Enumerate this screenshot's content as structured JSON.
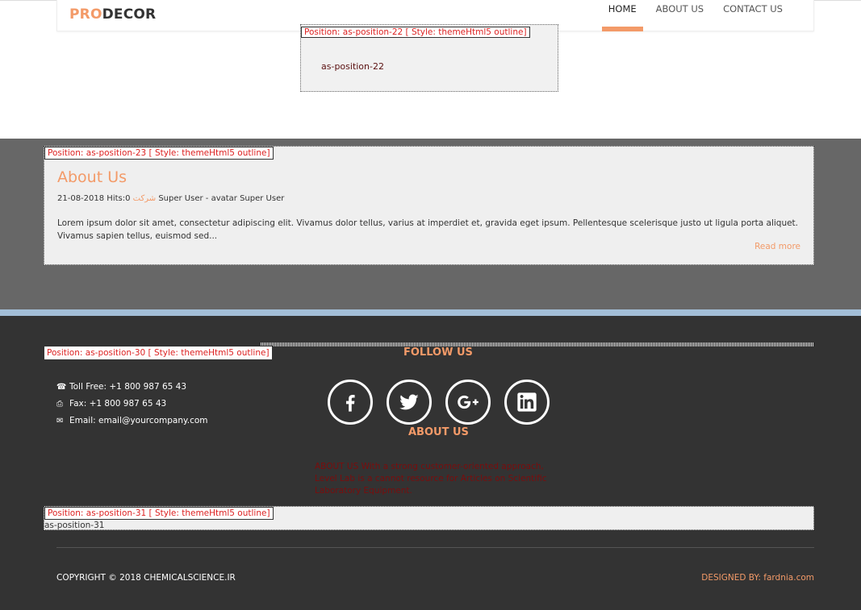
{
  "header": {
    "logo_pro": "PRO",
    "logo_decor": "DECOR",
    "nav": [
      {
        "label": "HOME"
      },
      {
        "label": "ABOUT US"
      },
      {
        "label": "CONTACT US"
      }
    ]
  },
  "pos22": {
    "tag": "Position: as-position-22 [ Style: themeHtml5 outline]",
    "body": "as-position-22"
  },
  "pos23": {
    "tag": "Position: as-position-23 [ Style: themeHtml5 outline]",
    "title": "About Us",
    "meta_date_hits": "21-08-2018 Hits:0",
    "meta_category": "شرکت",
    "meta_author": "Super User - avatar Super User",
    "excerpt": "Lorem ipsum dolor sit amet, consectetur adipiscing elit. Vivamus dolor tellus, varius at imperdiet et, gravida eget ipsum. Pellentesque scelerisque justo ut ligula porta aliquet. Vivamus sapien tellus, euismod sed...",
    "read_more": "Read more"
  },
  "pos30": {
    "tag": "Position: as-position-30 [ Style: themeHtml5 outline]",
    "follow_title": "FOLLOW US",
    "contact": {
      "toll_free": "Toll Free: +1 800 987 65 43",
      "fax": "Fax: +1 800 987 65 43",
      "email": "Email: email@yourcompany.com"
    },
    "socials": [
      "facebook-icon",
      "twitter-icon",
      "google-plus-icon",
      "linkedin-icon"
    ],
    "about_title": "ABOUT US",
    "about_text": "ABOUT US With a strong customer-oriented approach, Level Lab is a cannot resource for Articles on Scientific Laboratory Equipment."
  },
  "pos31": {
    "tag": "Position: as-position-31 [ Style: themeHtml5 outline]",
    "body": "as-position-31"
  },
  "footer": {
    "copyright": "COPYRIGHT © 2018 CHEMICALSCIENCE.IR",
    "designed_label": "DESIGNED BY:",
    "designed_link": "fardnia.com"
  },
  "colors": {
    "accent": "#f39a68",
    "footer_bg": "#333333",
    "band_bg": "#676767",
    "blue_line": "#a4bfd8"
  }
}
